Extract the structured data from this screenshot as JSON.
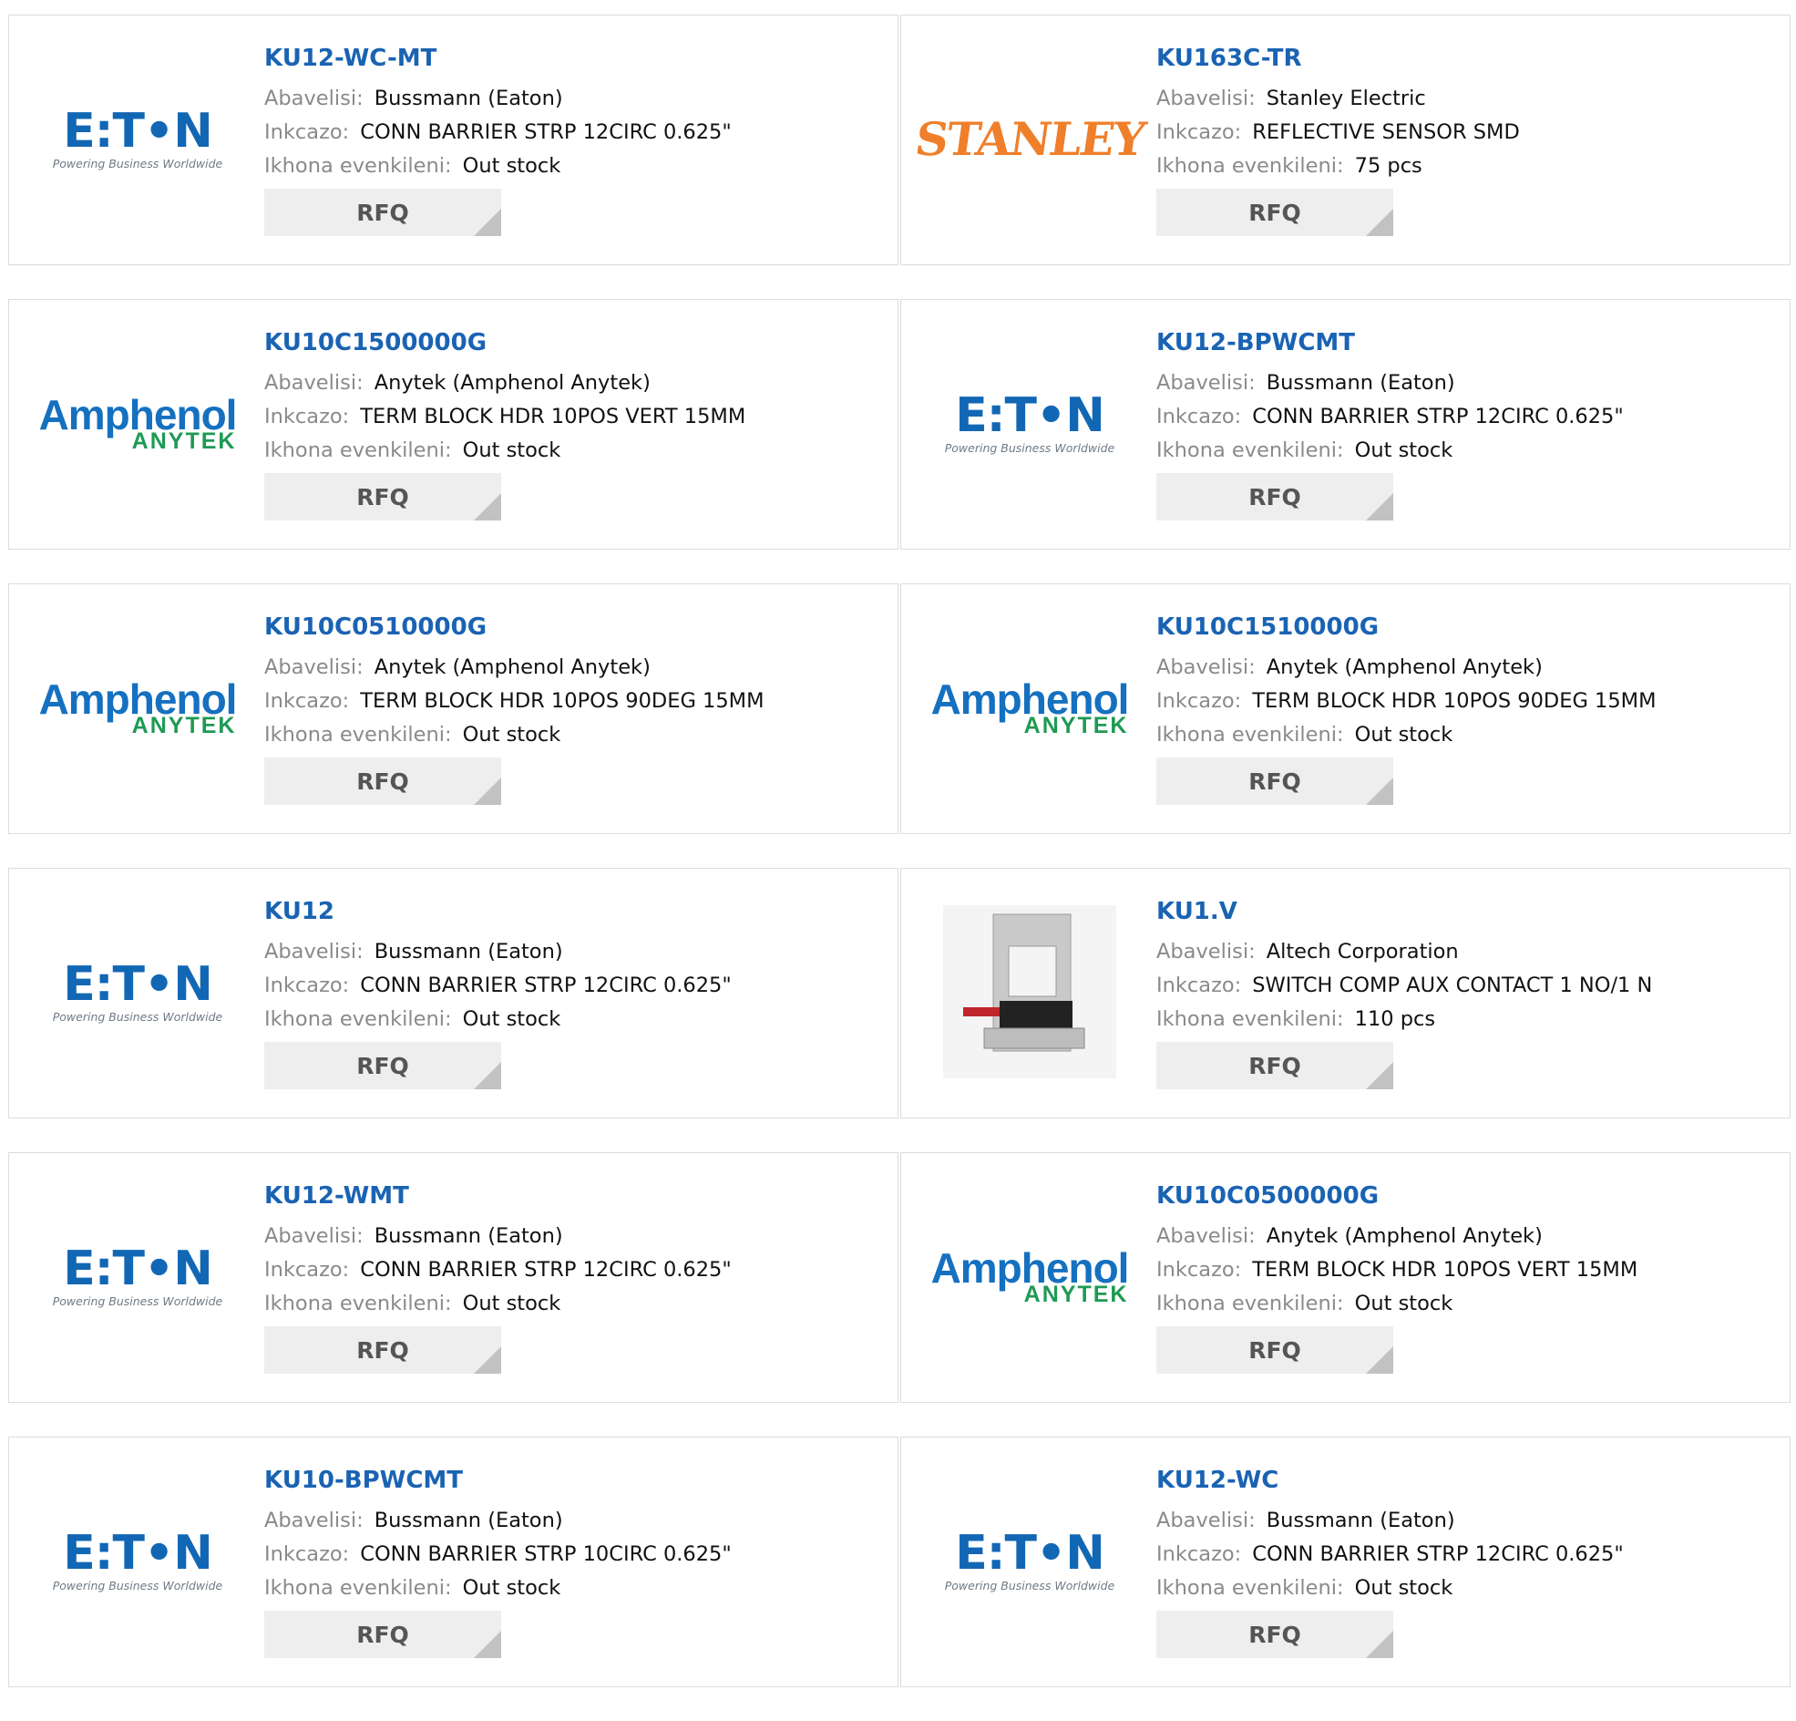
{
  "labels": {
    "manufacturer": "Abavelisi:",
    "description": "Inkcazo:",
    "stock": "Ikhona evenkileni:",
    "rfq": "RFQ"
  },
  "logos": {
    "eaton_word": "E:T•N",
    "eaton_tag": "Powering Business Worldwide",
    "amphenol_word": "Amphenol",
    "amphenol_sub": "ANYTEK",
    "stanley_word": "STANLEY"
  },
  "products": [
    {
      "part": "KU12-WC-MT",
      "manufacturer": "Bussmann (Eaton)",
      "description": "CONN BARRIER STRP 12CIRC 0.625\"",
      "stock": "Out stock",
      "logo": "eaton"
    },
    {
      "part": "KU163C-TR",
      "manufacturer": "Stanley Electric",
      "description": "REFLECTIVE SENSOR SMD",
      "stock": "75 pcs",
      "logo": "stanley"
    },
    {
      "part": "KU10C1500000G",
      "manufacturer": "Anytek (Amphenol Anytek)",
      "description": "TERM BLOCK HDR 10POS VERT 15MM",
      "stock": "Out stock",
      "logo": "amphenol"
    },
    {
      "part": "KU12-BPWCMT",
      "manufacturer": "Bussmann (Eaton)",
      "description": "CONN BARRIER STRP 12CIRC 0.625\"",
      "stock": "Out stock",
      "logo": "eaton"
    },
    {
      "part": "KU10C0510000G",
      "manufacturer": "Anytek (Amphenol Anytek)",
      "description": "TERM BLOCK HDR 10POS 90DEG 15MM",
      "stock": "Out stock",
      "logo": "amphenol"
    },
    {
      "part": "KU10C1510000G",
      "manufacturer": "Anytek (Amphenol Anytek)",
      "description": "TERM BLOCK HDR 10POS 90DEG 15MM",
      "stock": "Out stock",
      "logo": "amphenol"
    },
    {
      "part": "KU12",
      "manufacturer": "Bussmann (Eaton)",
      "description": "CONN BARRIER STRP 12CIRC 0.625\"",
      "stock": "Out stock",
      "logo": "eaton"
    },
    {
      "part": "KU1.V",
      "manufacturer": "Altech Corporation",
      "description": "SWITCH COMP AUX CONTACT 1 NO/1 N",
      "stock": "110 pcs",
      "logo": "photo"
    },
    {
      "part": "KU12-WMT",
      "manufacturer": "Bussmann (Eaton)",
      "description": "CONN BARRIER STRP 12CIRC 0.625\"",
      "stock": "Out stock",
      "logo": "eaton"
    },
    {
      "part": "KU10C0500000G",
      "manufacturer": "Anytek (Amphenol Anytek)",
      "description": "TERM BLOCK HDR 10POS VERT 15MM",
      "stock": "Out stock",
      "logo": "amphenol"
    },
    {
      "part": "KU10-BPWCMT",
      "manufacturer": "Bussmann (Eaton)",
      "description": "CONN BARRIER STRP 10CIRC 0.625\"",
      "stock": "Out stock",
      "logo": "eaton"
    },
    {
      "part": "KU12-WC",
      "manufacturer": "Bussmann (Eaton)",
      "description": "CONN BARRIER STRP 12CIRC 0.625\"",
      "stock": "Out stock",
      "logo": "eaton"
    }
  ]
}
